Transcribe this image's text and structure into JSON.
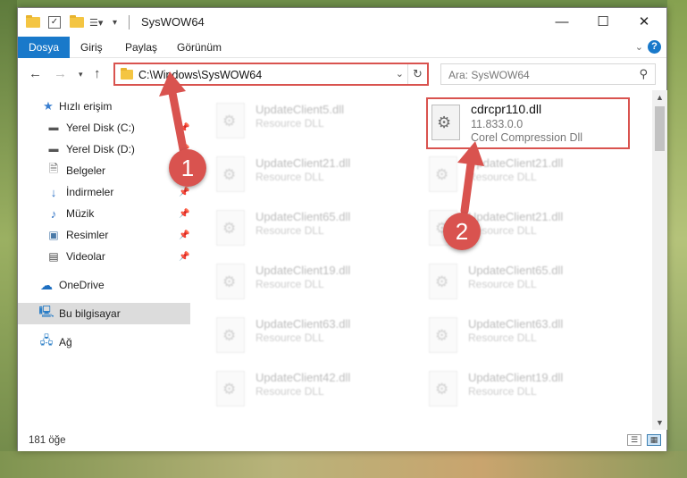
{
  "window": {
    "title": "SysWOW64",
    "controls": {
      "minimize": "—",
      "maximize": "☐",
      "close": "✕"
    }
  },
  "ribbon": {
    "tabs": [
      "Dosya",
      "Giriş",
      "Paylaş",
      "Görünüm"
    ],
    "active_tab": "Dosya",
    "accent": "#1979ca",
    "help": "?"
  },
  "nav": {
    "address": "C:\\Windows\\SysWOW64",
    "search_placeholder": "Ara: SysWOW64"
  },
  "sidebar": {
    "items": [
      {
        "label": "Hızlı erişim",
        "icon": "star-icon",
        "pinned": false
      },
      {
        "label": "Yerel Disk (C:)",
        "icon": "drive-icon",
        "pinned": true
      },
      {
        "label": "Yerel Disk (D:)",
        "icon": "drive-icon",
        "pinned": true
      },
      {
        "label": "Belgeler",
        "icon": "documents-icon",
        "pinned": true
      },
      {
        "label": "İndirmeler",
        "icon": "download-icon",
        "pinned": true
      },
      {
        "label": "Müzik",
        "icon": "music-icon",
        "pinned": true
      },
      {
        "label": "Resimler",
        "icon": "pictures-icon",
        "pinned": true
      },
      {
        "label": "Videolar",
        "icon": "video-icon",
        "pinned": true
      },
      {
        "label": "OneDrive",
        "icon": "cloud-icon",
        "pinned": false
      },
      {
        "label": "Bu bilgisayar",
        "icon": "computer-icon",
        "pinned": false,
        "selected": true
      },
      {
        "label": "Ağ",
        "icon": "network-icon",
        "pinned": false
      }
    ]
  },
  "files": {
    "left_column": [
      {
        "name": "UpdateClient5.dll",
        "desc": "Resource DLL"
      },
      {
        "name": "UpdateClient21.dll",
        "desc": "Resource DLL"
      },
      {
        "name": "UpdateClient65.dll",
        "desc": "Resource DLL"
      },
      {
        "name": "UpdateClient19.dll",
        "desc": "Resource DLL"
      },
      {
        "name": "UpdateClient63.dll",
        "desc": "Resource DLL"
      },
      {
        "name": "UpdateClient42.dll",
        "desc": "Resource DLL"
      }
    ],
    "right_column": [
      {
        "name": "UpdateClient21.dll",
        "desc": "Resource DLL"
      },
      {
        "name": "UpdateClient21.dll",
        "desc": "Resource DLL"
      },
      {
        "name": "UpdateClient65.dll",
        "desc": "Resource DLL"
      },
      {
        "name": "UpdateClient63.dll",
        "desc": "Resource DLL"
      },
      {
        "name": "UpdateClient19.dll",
        "desc": "Resource DLL"
      }
    ],
    "highlighted": {
      "name": "cdrcpr110.dll",
      "version": "11.833.0.0",
      "desc": "Corel Compression Dll"
    }
  },
  "status": {
    "count": "181 öğe"
  },
  "annotations": {
    "step1": "1",
    "step2": "2",
    "color": "#d9534f"
  }
}
